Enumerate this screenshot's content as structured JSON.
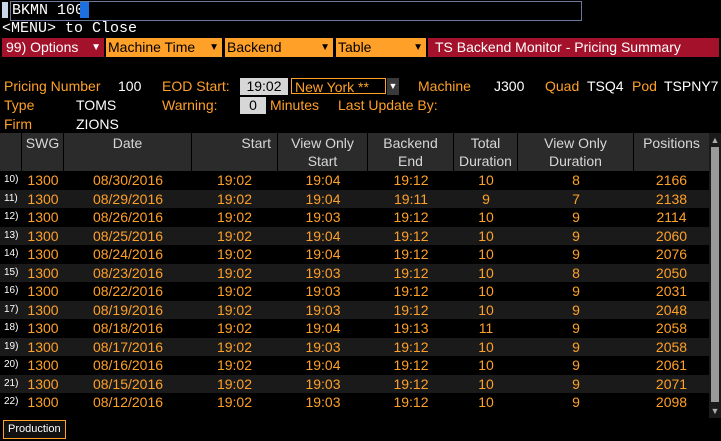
{
  "command": {
    "text": "BKMN 100"
  },
  "menu_hint": "<MENU> to Close",
  "toolbar": {
    "options": "99) Options",
    "machine_time": "Machine Time",
    "backend": "Backend",
    "table": "Table",
    "title": "TS Backend Monitor - Pricing Summary"
  },
  "info": {
    "pricing_number_label": "Pricing Number",
    "pricing_number": "100",
    "eod_start_label": "EOD Start:",
    "eod_start": "19:02",
    "timezone": "New York **",
    "machine_label": "Machine",
    "machine": "J300",
    "quad_label": "Quad",
    "quad": "TSQ4",
    "pod_label": "Pod",
    "pod": "TSPNY7",
    "type_label": "Type",
    "type": "TOMS",
    "warning_label": "Warning:",
    "warning": "0",
    "minutes_label": "Minutes",
    "last_update_label": "Last Update By:",
    "firm_label": "Firm",
    "firm": "ZIONS"
  },
  "table": {
    "headers": {
      "swg": "SWG",
      "date": "Date",
      "start": "Start",
      "view_only_start_1": "View Only",
      "view_only_start_2": "Start",
      "backend_end_1": "Backend",
      "backend_end_2": "End",
      "total_duration_1": "Total",
      "total_duration_2": "Duration",
      "view_only_duration_1": "View Only",
      "view_only_duration_2": "Duration",
      "positions": "Positions"
    },
    "rows": [
      [
        "10)",
        "1300",
        "08/30/2016",
        "19:02",
        "19:04",
        "19:12",
        "10",
        "8",
        "2166"
      ],
      [
        "11)",
        "1300",
        "08/29/2016",
        "19:02",
        "19:04",
        "19:11",
        "9",
        "7",
        "2138"
      ],
      [
        "12)",
        "1300",
        "08/26/2016",
        "19:02",
        "19:03",
        "19:12",
        "10",
        "9",
        "2114"
      ],
      [
        "13)",
        "1300",
        "08/25/2016",
        "19:02",
        "19:04",
        "19:12",
        "10",
        "9",
        "2060"
      ],
      [
        "14)",
        "1300",
        "08/24/2016",
        "19:02",
        "19:04",
        "19:12",
        "10",
        "9",
        "2076"
      ],
      [
        "15)",
        "1300",
        "08/23/2016",
        "19:02",
        "19:03",
        "19:12",
        "10",
        "8",
        "2050"
      ],
      [
        "16)",
        "1300",
        "08/22/2016",
        "19:02",
        "19:03",
        "19:12",
        "10",
        "9",
        "2031"
      ],
      [
        "17)",
        "1300",
        "08/19/2016",
        "19:02",
        "19:03",
        "19:12",
        "10",
        "9",
        "2048"
      ],
      [
        "18)",
        "1300",
        "08/18/2016",
        "19:02",
        "19:04",
        "19:13",
        "11",
        "9",
        "2058"
      ],
      [
        "19)",
        "1300",
        "08/17/2016",
        "19:02",
        "19:03",
        "19:12",
        "10",
        "9",
        "2058"
      ],
      [
        "20)",
        "1300",
        "08/16/2016",
        "19:02",
        "19:04",
        "19:12",
        "10",
        "9",
        "2061"
      ],
      [
        "21)",
        "1300",
        "08/15/2016",
        "19:02",
        "19:03",
        "19:12",
        "10",
        "9",
        "2071"
      ],
      [
        "22)",
        "1300",
        "08/12/2016",
        "19:02",
        "19:03",
        "19:12",
        "10",
        "9",
        "2098"
      ]
    ]
  },
  "footer": {
    "tab": "Production"
  },
  "colors": {
    "amber": "#ffa028",
    "red": "#a3122a",
    "header_bg": "#2b2b2b",
    "cursor": "#1e6fe0"
  }
}
